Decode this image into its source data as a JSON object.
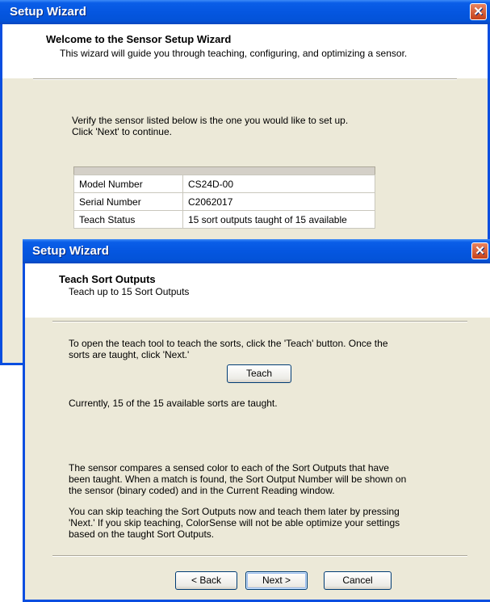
{
  "window1": {
    "title": "Setup Wizard",
    "header_title": "Welcome to the Sensor Setup Wizard",
    "header_subtitle": "This wizard will guide you through teaching, configuring, and optimizing a sensor.",
    "instruction_line1": "Verify the sensor listed below is the one you would like to set up.",
    "instruction_line2": "Click 'Next' to continue.",
    "table": [
      {
        "label": "Model Number",
        "value": "CS24D-00"
      },
      {
        "label": "Serial Number",
        "value": "C2062017"
      },
      {
        "label": "Teach Status",
        "value": "15 sort outputs taught of 15 available"
      }
    ]
  },
  "window2": {
    "title": "Setup Wizard",
    "header_title": "Teach Sort Outputs",
    "header_subtitle": "Teach up to 15 Sort Outputs",
    "teach_instruction_line1": "To open the teach tool to teach the sorts, click the 'Teach' button. Once the",
    "teach_instruction_line2": "sorts are taught, click 'Next.'",
    "teach_button": "Teach",
    "status_text": "Currently, 15 of the 15 available sorts are taught.",
    "para1_line1": "The sensor compares a sensed color to each of the Sort Outputs that have",
    "para1_line2": "been taught. When a match is found, the Sort Output Number will be shown on",
    "para1_line3": "the sensor (binary coded) and in the Current Reading window.",
    "para2_line1": "You can skip teaching the Sort Outputs now and teach them later by pressing",
    "para2_line2": "'Next.' If you skip teaching, ColorSense will not be able optimize your settings",
    "para2_line3": "based on the taught Sort Outputs.",
    "back_button": "< Back",
    "next_button": "Next >",
    "cancel_button": "Cancel"
  }
}
